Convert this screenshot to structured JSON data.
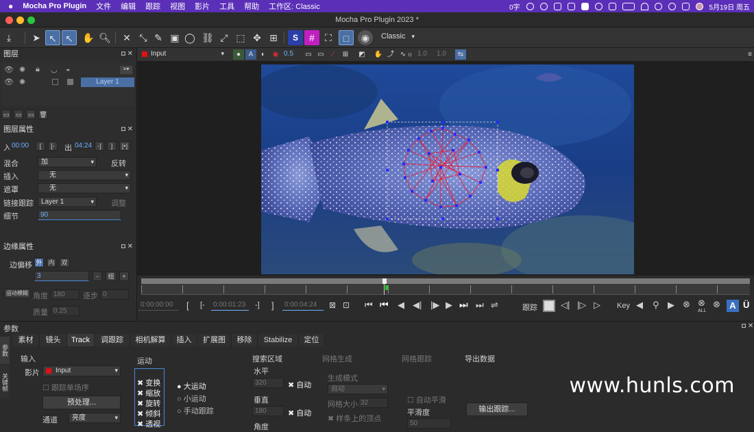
{
  "menubar": {
    "app_name": "Mocha Pro Plugin",
    "items": [
      "文件",
      "编辑",
      "跟踪",
      "视图",
      "影片",
      "工具",
      "帮助",
      "工作区: Classic"
    ],
    "right_items": {
      "zi": "0字",
      "date": "5月19日 周五"
    }
  },
  "window": {
    "title": "Mocha Pro Plugin 2023 *"
  },
  "toolbar": {
    "workspace_dropdown": "Classic"
  },
  "layers_panel": {
    "title": "图层",
    "layer_name": "Layer 1"
  },
  "layer_props": {
    "title": "图层属性",
    "in_label": "入",
    "in_value": "00:00",
    "out_label": "出",
    "out_value": "04:24",
    "blend_label": "混合",
    "blend_value": "加",
    "invert_label": "反转",
    "insert_label": "插入",
    "insert_value": "无",
    "mask_label": "遮罩",
    "mask_value": "无",
    "link_label": "链接跟踪",
    "link_value": "Layer 1",
    "adjust_label": "调整",
    "detail_label": "细节",
    "detail_value": "90"
  },
  "edge_props": {
    "title": "边缘属性",
    "offset_label": "边偏移",
    "offset_tabs": [
      "外",
      "内",
      "双"
    ],
    "offset_value": "3",
    "group_label": "组",
    "motion_blur_label": "运动模糊",
    "angle_label": "角度",
    "angle_value": "180",
    "step_label": "逐步",
    "step_value": "0",
    "quality_label": "质量",
    "quality_value": "0.25"
  },
  "viewbar": {
    "source_dropdown": "Input",
    "value1": "0.5",
    "value2": "1.0",
    "value3": "1.0"
  },
  "timeline": {
    "time_start": "0:00:00:00",
    "time_in": "0:00:01:23",
    "time_out": "0:00:04:24",
    "track_label": "跟踪",
    "key_label": "Key",
    "all_label": "ALL"
  },
  "params": {
    "title": "参数",
    "side_tabs": [
      "参数",
      "关键帧"
    ],
    "tabs": [
      "素材",
      "镜头",
      "Track",
      "调跟踪",
      "相机解算",
      "插入",
      "扩展图",
      "移除",
      "Stabilize",
      "定位"
    ],
    "active_tab": "Track",
    "input_label": "输入",
    "clip_label": "影片",
    "clip_value": "Input",
    "track_single_label": "跟踪单场序",
    "preprocess_button": "预处理...",
    "channel_label": "通道",
    "channel_value": "亮度",
    "motion_label": "运动",
    "motion_checks": [
      "变换",
      "缩放",
      "旋转",
      "倾斜",
      "透视"
    ],
    "motion_radios": [
      "大运动",
      "小运动",
      "手动跟踪"
    ],
    "search_label": "搜索区域",
    "horizontal_label": "水平",
    "horizontal_value": "320",
    "vertical_label": "垂直",
    "vertical_value": "180",
    "auto_label": "自动",
    "angle_label": "角度",
    "grid_gen_label": "网格生成",
    "grid_track_label": "网格跟踪",
    "gen_mode_label": "生成模式",
    "gen_mode_value": "自动",
    "grid_size_label": "网格大小",
    "grid_size_value": "32",
    "vertices_label": "样条上的顶点",
    "auto_smooth_label": "自动平滑",
    "smooth_label": "平滑度",
    "smooth_value": "50",
    "export_label": "导出数据",
    "export_button": "输出跟踪..."
  },
  "watermark": "www.hunls.com",
  "colors": {
    "accent": "#5b2fb8",
    "selection": "#4a6fa5",
    "mesh": "#e0203a",
    "vertex": "#2a2aff"
  }
}
